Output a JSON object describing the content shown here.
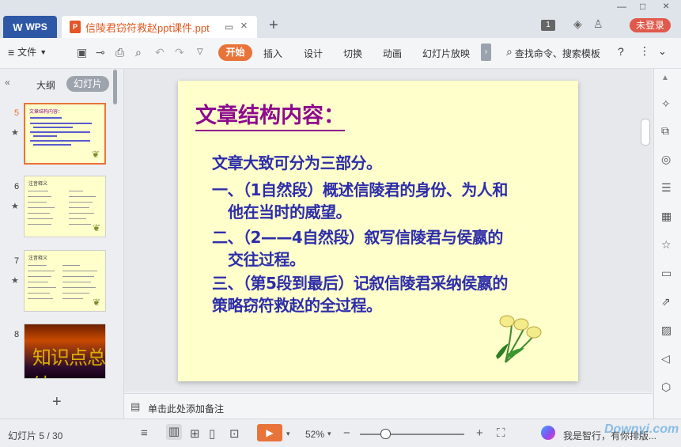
{
  "titlebar": {
    "app_tab": "WPS",
    "doc_tab": "信陵君窃符救赵ppt课件.ppt",
    "tab_count": "1",
    "login_label": "未登录"
  },
  "menubar": {
    "file": "文件",
    "items": [
      "开始",
      "插入",
      "设计",
      "切换",
      "动画",
      "幻灯片放映"
    ],
    "search": "查找命令、搜索模板",
    "help": "?"
  },
  "leftpanel": {
    "tab_outline": "大纲",
    "tab_slides": "幻灯片",
    "thumbs": [
      {
        "num": "5",
        "title": "文章结构内容："
      },
      {
        "num": "6",
        "title": "注音释义"
      },
      {
        "num": "7",
        "title": "注音释义"
      },
      {
        "num": "8",
        "title": "知识点总结"
      }
    ]
  },
  "slide": {
    "title": "文章结构内容：",
    "lines": [
      "文章大致可分为三部分。",
      "一、（1自然段）概述信陵君的身份、为人和",
      "他在当时的威望。",
      "二、（2——4自然段）叙写信陵君与侯嬴的",
      "交往过程。",
      "三、（第5段到最后）记叙信陵君采纳侯嬴的",
      "策略窃符救赵的全过程。"
    ],
    "colors": {
      "background": "#ffffcc",
      "title": "#8e0a8e",
      "body": "#2d2daa"
    }
  },
  "notes": {
    "placeholder": "单击此处添加备注"
  },
  "statusbar": {
    "slide_indicator": "幻灯片 5 / 30",
    "zoom": "52%",
    "zoom_level": 0.52,
    "assistant_text": "我是智行，有你排版...",
    "watermark": "Downyi.com"
  },
  "theme": {
    "accent": "#e8743a",
    "wps_blue": "#2e58a6"
  }
}
